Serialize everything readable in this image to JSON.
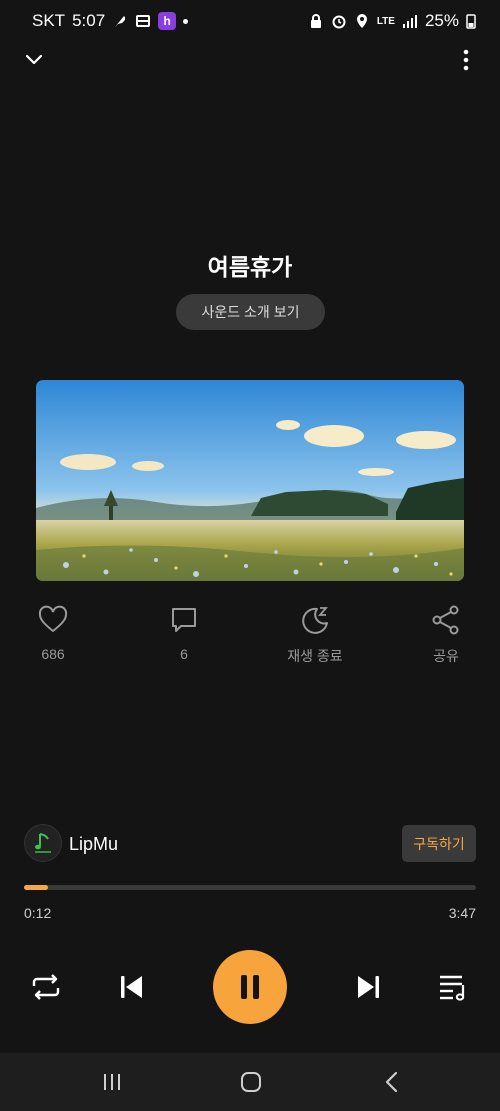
{
  "status_bar": {
    "carrier": "SKT",
    "time": "5:07",
    "battery": "25%",
    "network": "LTE"
  },
  "track": {
    "title": "여름휴가",
    "intro_button": "사운드 소개 보기"
  },
  "actions": [
    {
      "icon": "heart-icon",
      "label": "686"
    },
    {
      "icon": "comment-icon",
      "label": "6"
    },
    {
      "icon": "sleep-timer-icon",
      "label": "재생 종료"
    },
    {
      "icon": "share-icon",
      "label": "공유"
    }
  ],
  "channel": {
    "name": "LipMu",
    "subscribe_label": "구독하기"
  },
  "playback": {
    "current_time": "0:12",
    "total_time": "3:47",
    "progress_fraction": 0.053
  },
  "colors": {
    "accent": "#f6a43b",
    "background": "#141414"
  }
}
